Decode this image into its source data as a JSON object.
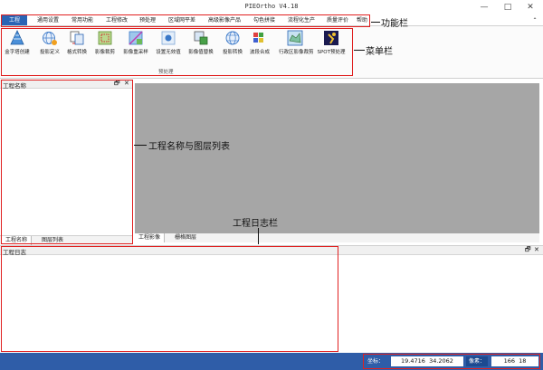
{
  "window": {
    "title": "PIEOrtho V4.18",
    "min": "—",
    "max": "□",
    "close": "✕"
  },
  "menu": {
    "tabs": [
      {
        "label": "工程",
        "active": true
      },
      {
        "label": "通用设置"
      },
      {
        "label": "常用功能"
      },
      {
        "label": "工程修改"
      },
      {
        "label": "预处理"
      },
      {
        "label": "区域网平差"
      },
      {
        "label": "高级影像产品"
      },
      {
        "label": "勾色拼接"
      },
      {
        "label": "流程化生产"
      },
      {
        "label": "质量评价"
      },
      {
        "label": "帮助"
      }
    ],
    "collapse": "⌃"
  },
  "ribbon": {
    "buttons": [
      {
        "label": "金字塔创建",
        "icon": "pyramid-icon"
      },
      {
        "label": "投影定义",
        "icon": "projection-define-icon"
      },
      {
        "label": "格式转换",
        "icon": "format-convert-icon"
      },
      {
        "label": "影像裁剪",
        "icon": "image-clip-icon"
      },
      {
        "label": "影像重采样",
        "icon": "resample-icon"
      },
      {
        "label": "设置无效值",
        "icon": "nodata-icon"
      },
      {
        "label": "影像值替换",
        "icon": "value-replace-icon"
      },
      {
        "label": "投影转换",
        "icon": "projection-convert-icon"
      },
      {
        "label": "波段合成",
        "icon": "band-composite-icon"
      },
      {
        "label": "行政区影像裁剪",
        "icon": "region-clip-icon"
      },
      {
        "label": "SPOT预处理",
        "icon": "spot-preprocess-icon"
      }
    ],
    "group_label": "预处理"
  },
  "annotations": {
    "menu": "功能栏",
    "ribbon": "菜单栏",
    "project": "工程名称与图层列表",
    "log": "工程日志栏"
  },
  "project_panel": {
    "title": "工程名称",
    "pin": "🗗",
    "close": "✕",
    "tabs": [
      "工程名称",
      "图层列表"
    ]
  },
  "view": {
    "tabs": [
      "工程影像",
      "栅格图层"
    ]
  },
  "log_panel": {
    "title": "工程日志",
    "pin": "🗗",
    "close": "✕"
  },
  "status": {
    "coord_label": "坐标：",
    "coord_x": "19.4716",
    "coord_y": "34.2062",
    "pixel_label": "像素：",
    "pixel_x": "166",
    "pixel_y": "18"
  },
  "colors": {
    "accent": "#2a64b4",
    "status_bar": "#2f5da8",
    "annotation_red": "#e02020",
    "view_bg": "#a6a6a6"
  }
}
